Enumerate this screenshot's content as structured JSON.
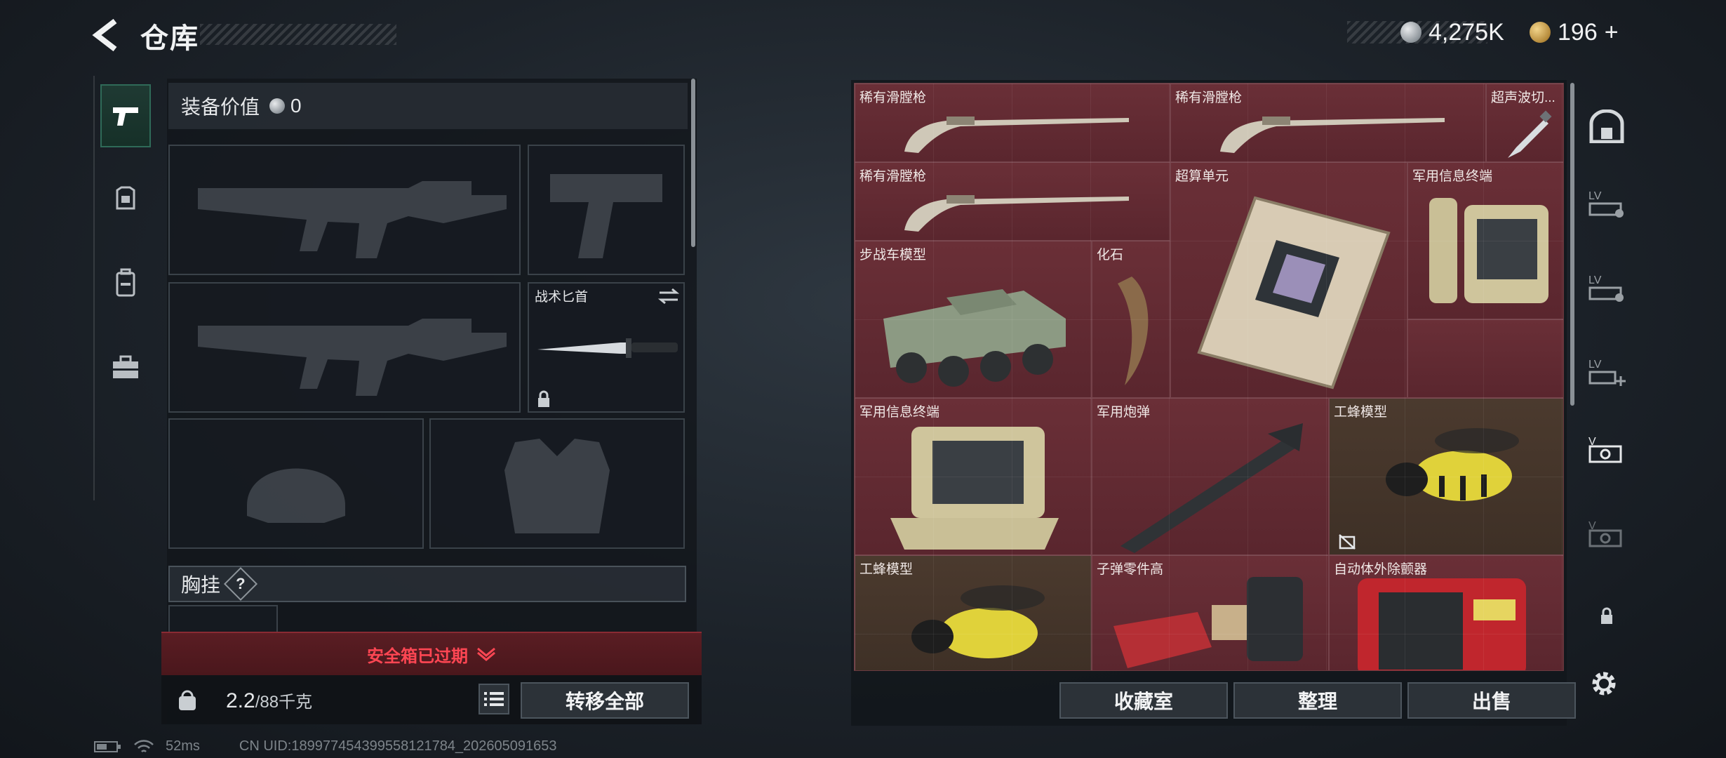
{
  "header": {
    "title": "仓库"
  },
  "currency": {
    "silver": "4,275K",
    "gold": "196",
    "gold_plus": "+"
  },
  "left": {
    "equip_value_label": "装备价值",
    "equip_value": "0",
    "knife_label": "战术匕首",
    "chest_label": "胸挂",
    "chest_help": "?",
    "safe_box": "安全箱已过期",
    "weight_current": "2.2",
    "weight_max": "/88千克",
    "transfer_all": "转移全部"
  },
  "grid": {
    "items": [
      "稀有滑膛枪",
      "稀有滑膛枪",
      "超声波切...",
      "稀有滑膛枪",
      "超算单元",
      "军用信息终端",
      "步战车模型",
      "化石",
      "军用信息终端",
      "军用炮弹",
      "工蜂模型",
      "工蜂模型",
      "子弹零件高",
      "自动体外除颤器"
    ]
  },
  "bottom": {
    "collection": "收藏室",
    "sort": "整理",
    "sell": "出售"
  },
  "footer": {
    "ping": "52ms",
    "uid": "CN UID:18997745439955812178​4_202605091653"
  },
  "colors": {
    "red_cell": "#6a2f37",
    "brown_cell": "#4b3a2e",
    "warning": "#ff4653",
    "accent_green": "#2f6a58"
  },
  "icons": {
    "left_tabs": [
      "pistol-icon",
      "armor-icon",
      "backpack-icon",
      "toolbox-icon"
    ],
    "right_tabs": [
      "vault-icon",
      "level-upgrade-icon",
      "level-upgrade-icon",
      "level-add-icon",
      "vault-expand-icon",
      "vault-expand-locked-icon",
      "lock-icon"
    ]
  }
}
